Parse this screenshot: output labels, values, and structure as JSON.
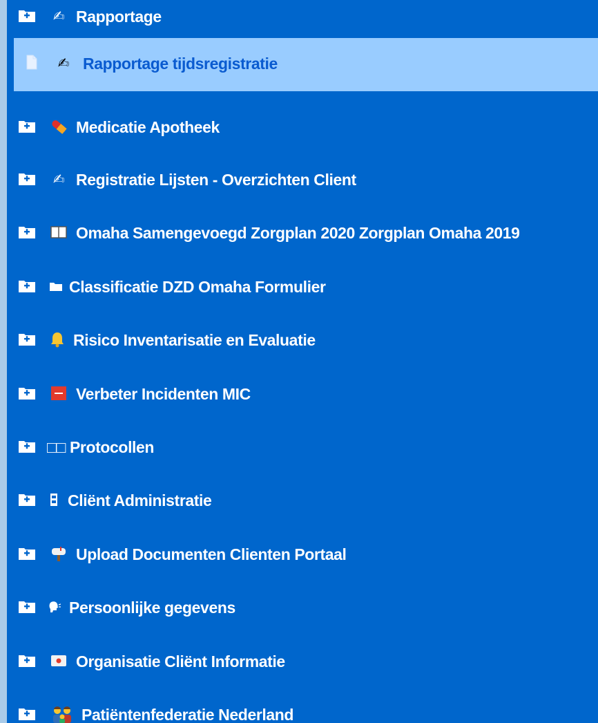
{
  "tree": {
    "items": [
      {
        "label": "Rapportage",
        "icon": "writing-hand-icon"
      },
      {
        "label": "Medicatie Apotheek",
        "icon": "pill-icon"
      },
      {
        "label": "Registratie Lijsten - Overzichten Client",
        "icon": "writing-hand-icon"
      },
      {
        "label": "Omaha Samengevoegd Zorgplan 2020 Zorgplan Omaha 2019",
        "icon": "book-icon"
      },
      {
        "label": "Classificatie DZD Omaha Formulier",
        "icon": "folder-icon"
      },
      {
        "label": "Risico Inventarisatie en Evaluatie",
        "icon": "bell-icon"
      },
      {
        "label": "Verbeter Incidenten MIC",
        "icon": "sos-icon"
      },
      {
        "label": "□□ Protocollen",
        "icon": "none"
      },
      {
        "label": "Cliënt Administratie",
        "icon": "cabinet-icon"
      },
      {
        "label": "Upload Documenten Clienten Portaal",
        "icon": "mailbox-icon"
      },
      {
        "label": "Persoonlijke gegevens",
        "icon": "speaking-head-icon"
      },
      {
        "label": "Organisatie Cliënt Informatie",
        "icon": "id-card-icon"
      },
      {
        "label": "Patiëntenfederatie Nederland",
        "icon": "family-icon"
      }
    ],
    "selected_child": {
      "label": "Rapportage tijdsregistratie",
      "icon": "writing-hand-icon"
    }
  },
  "colors": {
    "panel": "#0066cc",
    "selected_bg": "#99ccff",
    "selected_text": "#0a5bd0",
    "frame": "#a9cbe9"
  }
}
